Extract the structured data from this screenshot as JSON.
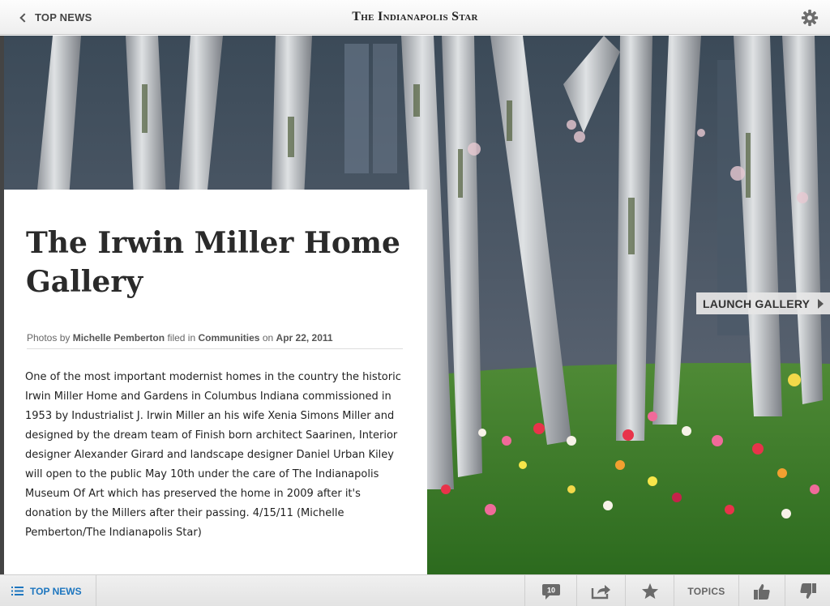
{
  "header": {
    "back_label": "TOP NEWS",
    "brand": "The Indianapolis Star"
  },
  "article": {
    "title": "The Irwin Miller Home Gallery",
    "meta": {
      "photos_prefix": "Photos by",
      "author": "Michelle Pemberton",
      "filed_prefix": "filed in",
      "section": "Communities",
      "date_prefix": "on",
      "date": "Apr 22, 2011"
    },
    "body": "One of the most important modernist homes in the country the historic Irwin Miller Home and Gardens in Columbus Indiana commissioned in 1953 by Industrialist J. Irwin Miller an his wife Xenia Simons Miller and designed by the dream team of Finish born architect Saarinen, Interior designer Alexander Girard and landscape designer Daniel Urban Kiley will open to the public May 10th under the care of The Indianapolis Museum Of Art which has preserved the home in 2009 after it's donation by the Millers after their passing. 4/15/11 (Michelle Pemberton/The Indianapolis Star)"
  },
  "gallery": {
    "launch_label": "LAUNCH GALLERY"
  },
  "toolbar": {
    "top_news_label": "TOP NEWS",
    "comment_count": "10",
    "topics_label": "TOPICS"
  },
  "colors": {
    "accent": "#1d76bf",
    "text_dark": "#2a2a2a"
  },
  "icons": [
    "chevron-left-icon",
    "gear-icon",
    "list-icon",
    "comment-icon",
    "share-icon",
    "star-icon",
    "thumbs-up-icon",
    "thumbs-down-icon"
  ]
}
